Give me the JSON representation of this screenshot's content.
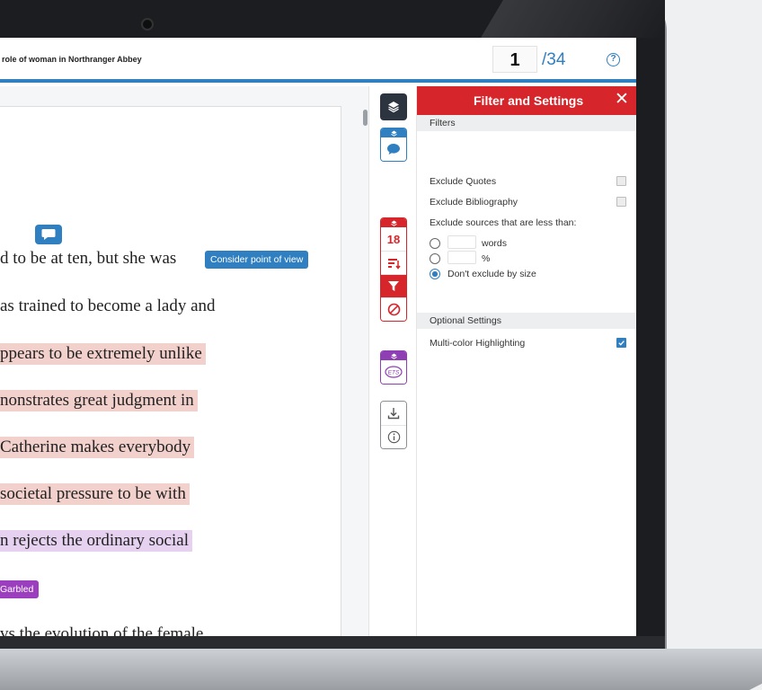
{
  "header": {
    "doc_title": "role of woman in Northranger Abbey",
    "current_page": "1",
    "total_pages": "/34",
    "help_label": "?"
  },
  "document": {
    "lines": [
      {
        "text": "d to be at ten, but she was",
        "highlight": "none"
      },
      {
        "text": "as trained to become a lady and",
        "highlight": "none"
      },
      {
        "text": "ppears to be extremely unlike",
        "highlight": "pink"
      },
      {
        "text": "nonstrates great judgment in",
        "highlight": "pink"
      },
      {
        "text": "Catherine makes everybody",
        "highlight": "pink"
      },
      {
        "text": " societal pressure to be with",
        "highlight": "pink"
      },
      {
        "text": "n rejects the ordinary social",
        "highlight": "purple"
      },
      {
        "text": "vs the evolution of the female",
        "highlight": "none"
      }
    ],
    "tags": {
      "consider": "Consider point of view",
      "garbled": "Garbled"
    }
  },
  "rail": {
    "similarity_count": "18",
    "colors": {
      "blue": "#2f7fc1",
      "red": "#d7262b",
      "purple": "#8e3fb3",
      "dark": "#2c3440"
    },
    "icons": [
      "layers-icon",
      "comment-icon",
      "sort-icon",
      "filter-icon",
      "exclude-icon",
      "ets-icon",
      "download-icon",
      "info-icon"
    ],
    "ets_label": "ETS"
  },
  "panel": {
    "title": "Filter and Settings",
    "close_label": "✕",
    "filters_heading": "Filters",
    "exclude_quotes": "Exclude Quotes",
    "exclude_quotes_checked": false,
    "exclude_bibliography": "Exclude Bibliography",
    "exclude_bibliography_checked": false,
    "exclude_sources_label": "Exclude sources that are less than:",
    "words_label": "words",
    "percent_label": "%",
    "dont_exclude_label": "Don't exclude by size",
    "optional_heading": "Optional Settings",
    "multicolor_label": "Multi-color Highlighting",
    "multicolor_checked": true
  }
}
